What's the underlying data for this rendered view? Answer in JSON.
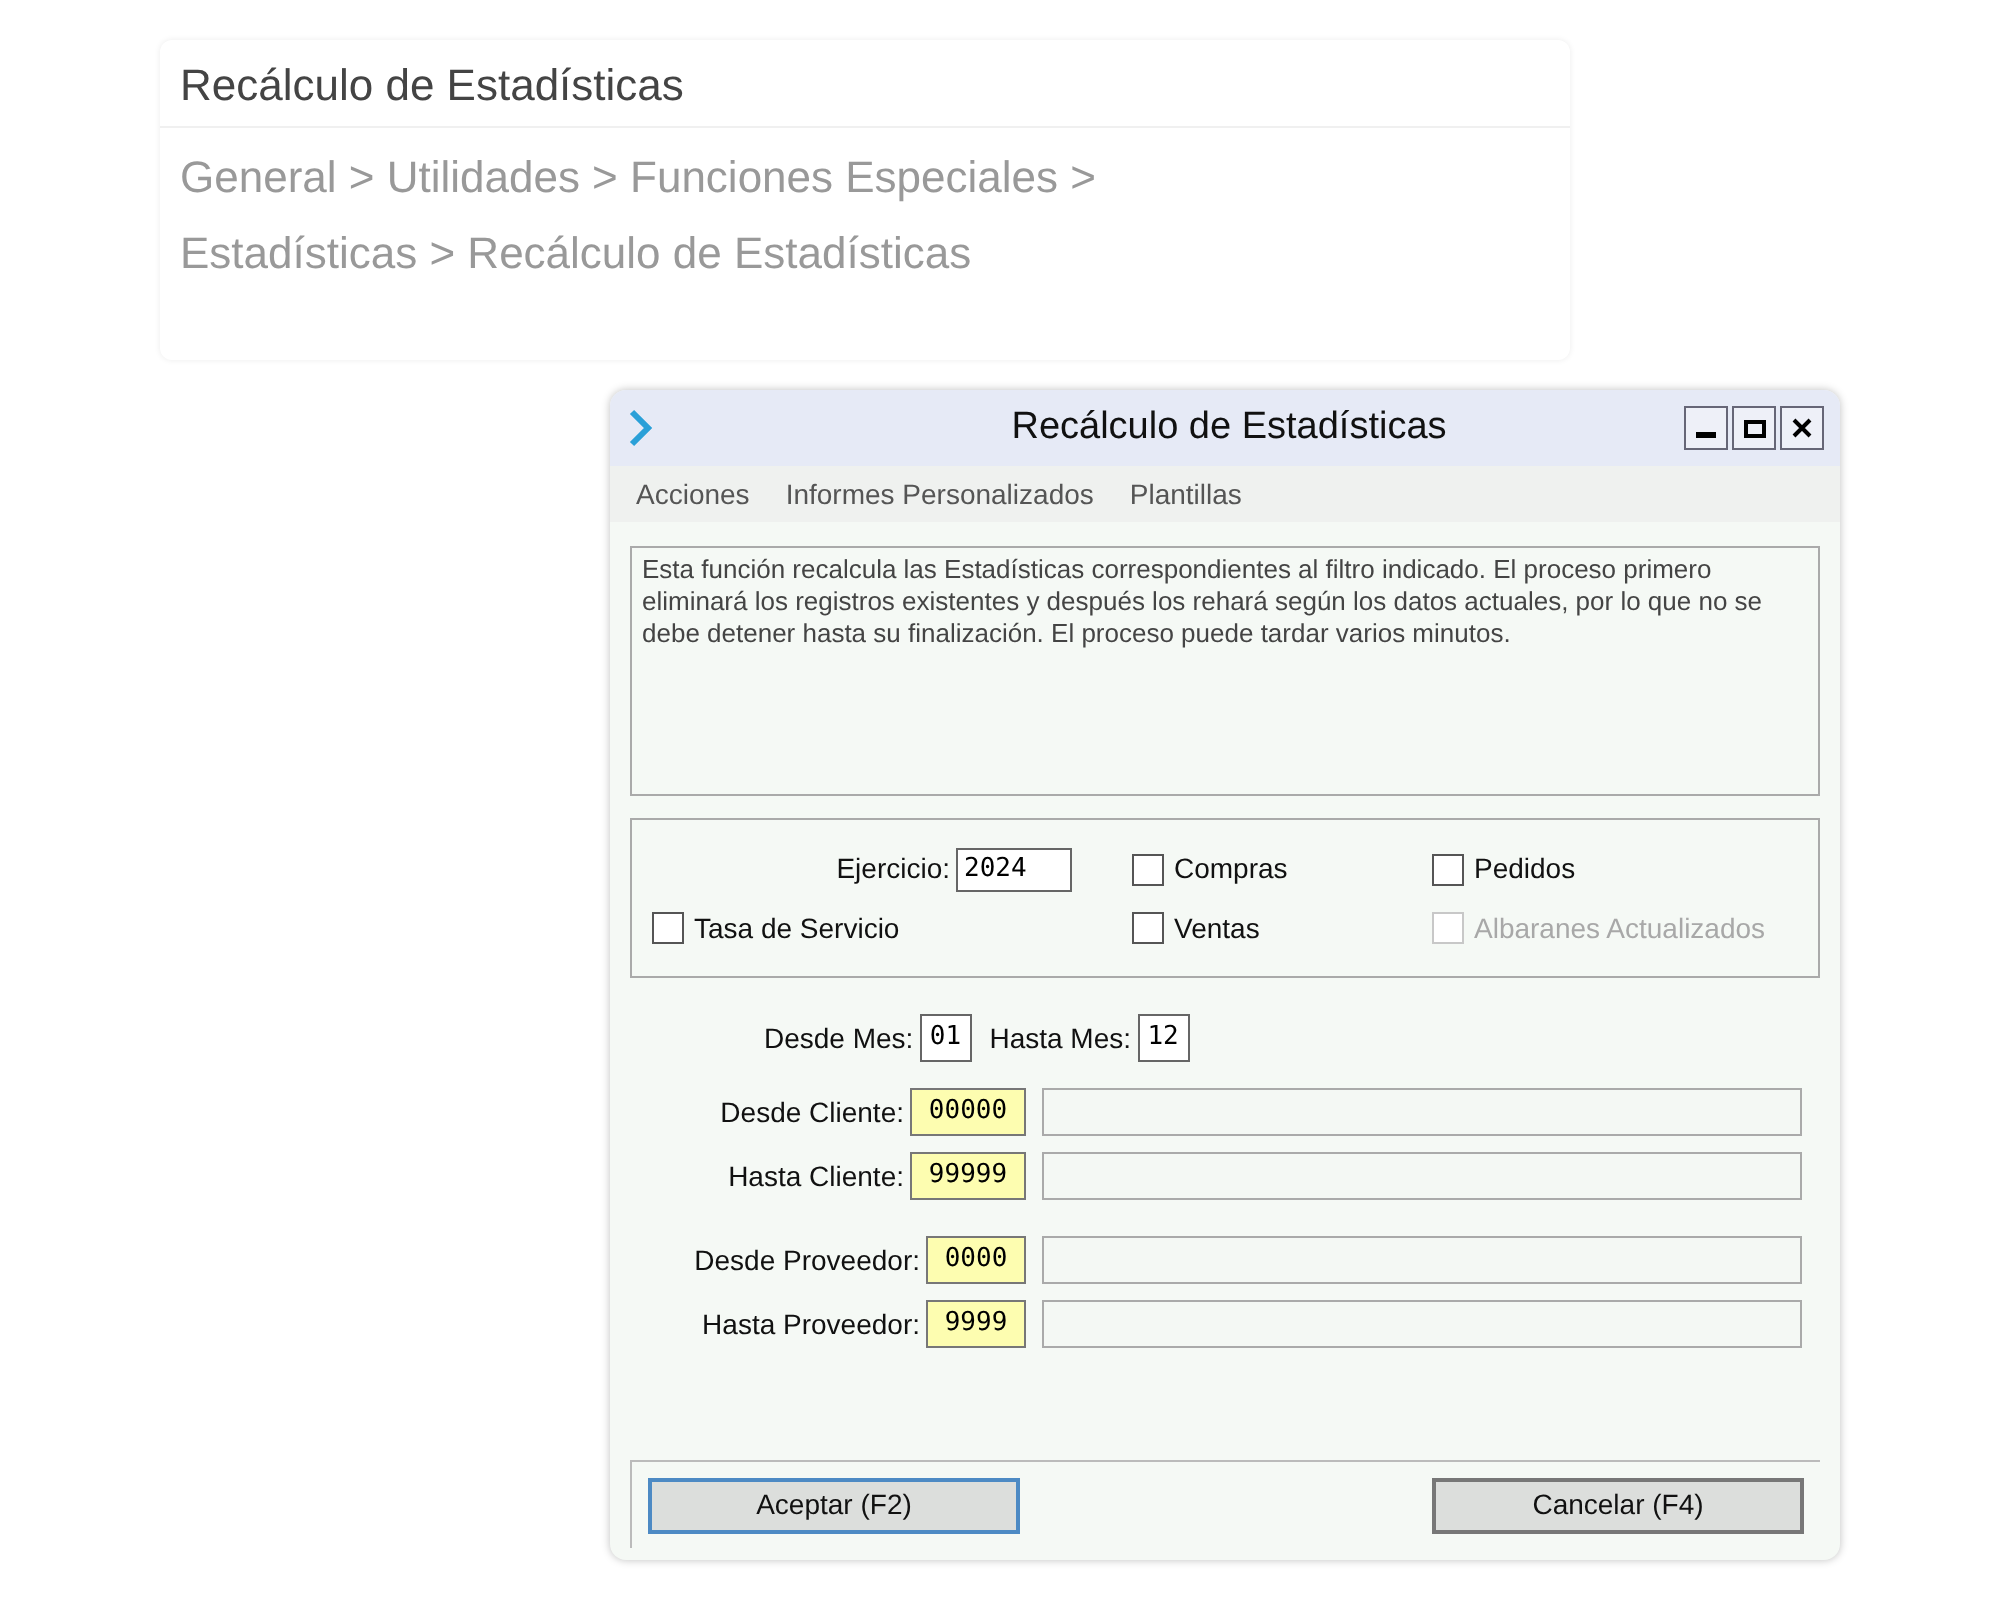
{
  "header": {
    "title": "Recálculo de Estadísticas",
    "path": "General > Utilidades > Funciones Especiales > Estadísticas > Recálculo de Estadísticas"
  },
  "window": {
    "title": "Recálculo de Estadísticas"
  },
  "menu": [
    "Acciones",
    "Informes Personalizados",
    "Plantillas"
  ],
  "description": "Esta función recalcula las Estadísticas correspondientes al filtro indicado. El proceso primero eliminará los registros existentes y después los rehará según los datos actuales, por lo que no se debe detener hasta su finalización. El proceso puede tardar varios minutos.",
  "options": [
    {
      "kind": "field",
      "label": "Ejercicio:",
      "value": "2024"
    },
    {
      "kind": "checkbox",
      "label": "Compras",
      "checked": false,
      "disabled": false
    },
    {
      "kind": "checkbox",
      "label": "Pedidos",
      "checked": false,
      "disabled": false
    },
    {
      "kind": "checkbox",
      "label": "Tasa de Servicio",
      "checked": false,
      "disabled": false
    },
    {
      "kind": "checkbox",
      "label": "Ventas",
      "checked": false,
      "disabled": false
    },
    {
      "kind": "checkbox",
      "label": "Albaranes Actualizados",
      "checked": false,
      "disabled": true
    }
  ],
  "months": [
    {
      "label": "Desde Mes:",
      "value": "01"
    },
    {
      "label": "Hasta Mes:",
      "value": "12"
    }
  ],
  "client_ranges": [
    {
      "label": "Desde Cliente:",
      "code": "00000"
    },
    {
      "label": "Hasta Cliente:",
      "code": "99999"
    }
  ],
  "supplier_ranges": [
    {
      "label": "Desde Proveedor:",
      "code": "0000"
    },
    {
      "label": "Hasta Proveedor:",
      "code": "9999"
    }
  ],
  "buttons": [
    {
      "label": "Aceptar (F2)",
      "focused": true
    },
    {
      "label": "Cancelar (F4)",
      "focused": false
    }
  ]
}
